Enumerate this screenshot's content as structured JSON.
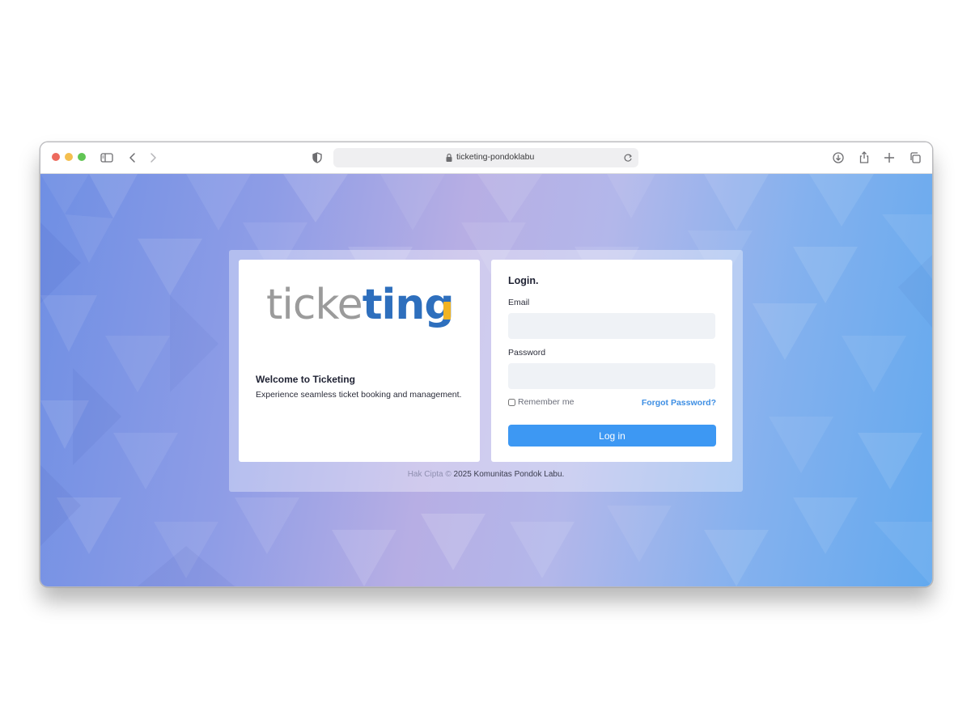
{
  "browser": {
    "url": "ticketing-pondoklabu",
    "icons": [
      "sidebar-icon",
      "back-icon",
      "forward-icon",
      "shield-icon",
      "lock-icon",
      "reload-icon",
      "download-icon",
      "share-icon",
      "new-tab-icon",
      "tabs-icon"
    ]
  },
  "brand": {
    "logo_part1": "ticke",
    "logo_part2": "ting",
    "logo_colors": {
      "grey": "#9b9b9b",
      "blue": "#2e6fbd",
      "tag": "#f0b323"
    }
  },
  "welcome": {
    "title": "Welcome to Ticketing",
    "subtitle": "Experience seamless ticket booking and management."
  },
  "login": {
    "title": "Login.",
    "email_label": "Email",
    "email_value": "",
    "password_label": "Password",
    "password_value": "",
    "remember_label": "Remember me",
    "remember_checked": false,
    "forgot_label": "Forgot Password?",
    "submit_label": "Log in",
    "accent_color": "#3d98f3"
  },
  "footer": {
    "prefix": "Hak Cipta ©",
    "text": "2025 Komunitas Pondok Labu."
  }
}
